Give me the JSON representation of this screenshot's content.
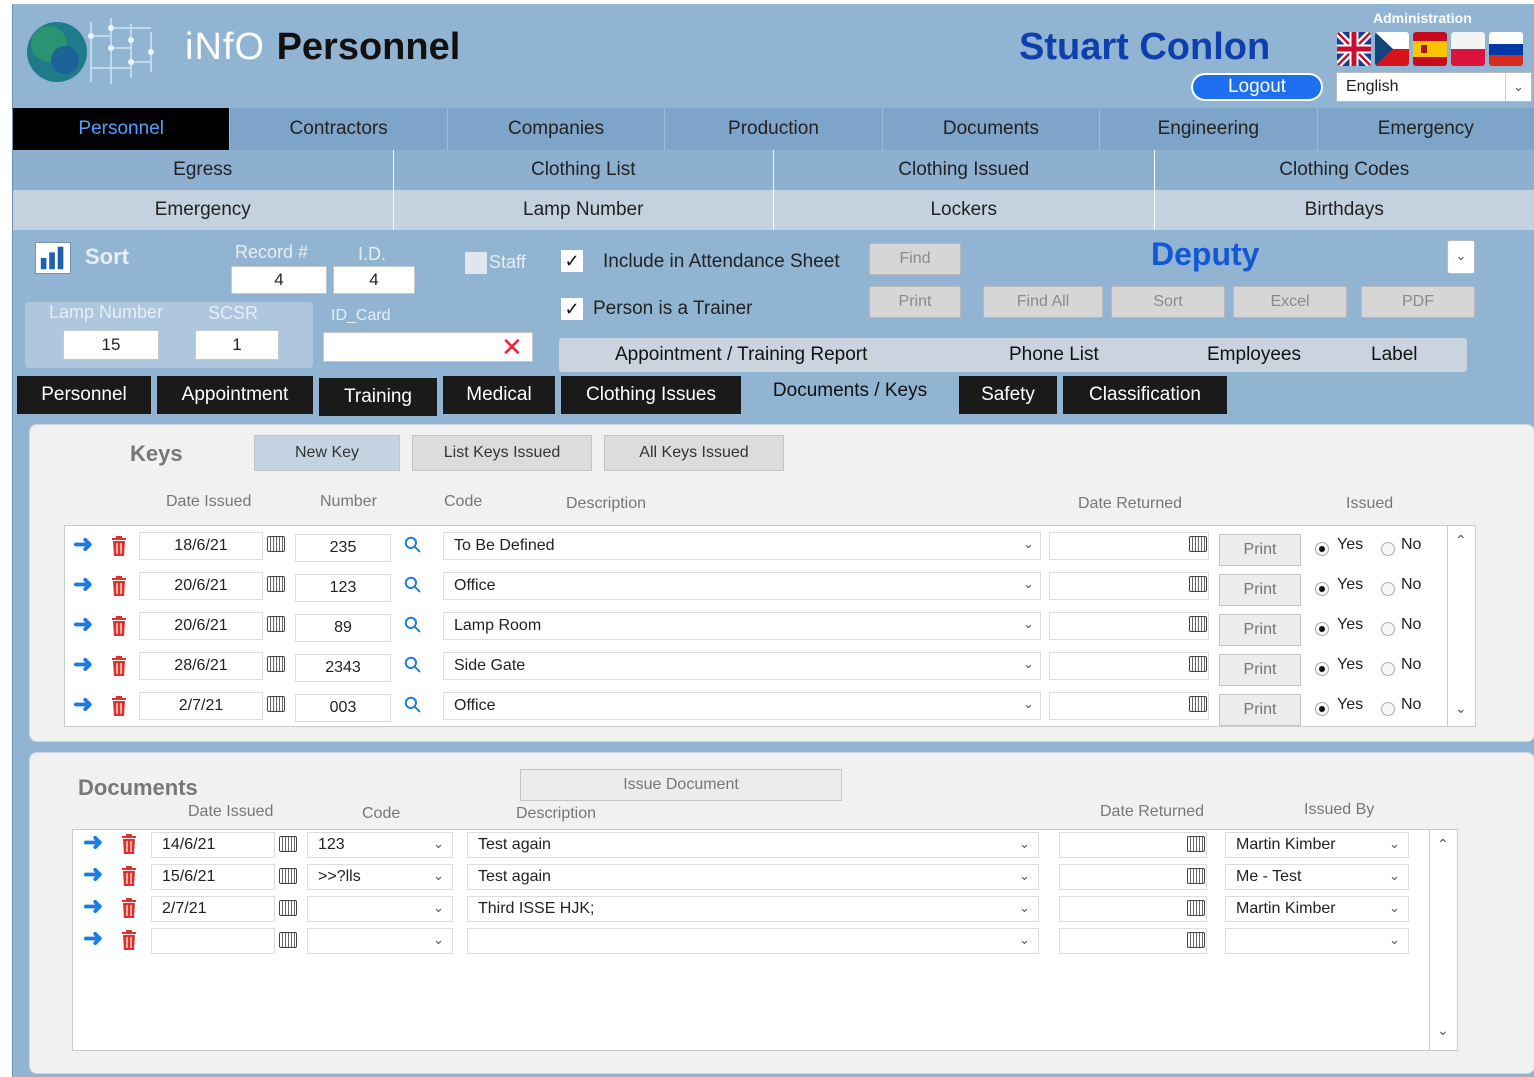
{
  "header": {
    "app_title_light": "iNfO",
    "app_title_bold": "Personnel",
    "user_name": "Stuart Conlon",
    "logout_label": "Logout",
    "admin_label": "Administration",
    "language_value": "English",
    "flags": [
      "uk-flag",
      "czech-flag",
      "spain-flag",
      "poland-flag",
      "russia-flag"
    ]
  },
  "main_nav": [
    "Personnel",
    "Contractors",
    "Companies",
    "Production",
    "Documents",
    "Engineering",
    "Emergency"
  ],
  "sub_nav_row1": [
    "Egress",
    "Clothing List",
    "Clothing Issued",
    "Clothing Codes"
  ],
  "sub_nav_row2": [
    "Emergency",
    "Lamp Number",
    "Lockers",
    "Birthdays"
  ],
  "record": {
    "sort_label": "Sort",
    "record_label": "Record #",
    "record_value": "4",
    "id_label": "I.D.",
    "id_value": "4",
    "lamp_label": "Lamp Number",
    "lamp_value": "15",
    "scsr_label": "SCSR",
    "scsr_value": "1",
    "idcard_label": "ID_Card",
    "idcard_value": "",
    "staff_label": "Staff",
    "attendance_label": "Include in Attendance Sheet",
    "trainer_label": "Person is a Trainer",
    "role_value": "Deputy"
  },
  "actions": {
    "find": "Find",
    "print": "Print",
    "find_all": "Find All",
    "sort": "Sort",
    "excel": "Excel",
    "pdf": "PDF"
  },
  "reports": [
    "Appointment / Training Report",
    "Phone List",
    "Employees",
    "Label"
  ],
  "tabs": [
    "Personnel",
    "Appointment",
    "Training",
    "Medical",
    "Clothing Issues",
    "Documents / Keys",
    "Safety",
    "Classification"
  ],
  "keys": {
    "title": "Keys",
    "new_key": "New Key",
    "list_keys": "List Keys Issued",
    "all_keys": "All Keys Issued",
    "columns": {
      "date_issued": "Date Issued",
      "number": "Number",
      "code": "Code",
      "description": "Description",
      "date_returned": "Date Returned",
      "issued": "Issued"
    },
    "print_label": "Print",
    "yes": "Yes",
    "no": "No",
    "rows": [
      {
        "date": "18/6/21",
        "number": "235",
        "description": "To Be Defined",
        "returned": ""
      },
      {
        "date": "20/6/21",
        "number": "123",
        "description": "Office",
        "returned": ""
      },
      {
        "date": "20/6/21",
        "number": "89",
        "description": "Lamp Room",
        "returned": ""
      },
      {
        "date": "28/6/21",
        "number": "2343",
        "description": "Side Gate",
        "returned": ""
      },
      {
        "date": "2/7/21",
        "number": "003",
        "description": "Office",
        "returned": ""
      }
    ]
  },
  "documents": {
    "title": "Documents",
    "issue_document": "Issue Document",
    "columns": {
      "date_issued": "Date Issued",
      "code": "Code",
      "description": "Description",
      "date_returned": "Date Returned",
      "issued_by": "Issued By"
    },
    "rows": [
      {
        "date": "14/6/21",
        "code": "123",
        "description": "Test again",
        "returned": "",
        "issued_by": "Martin Kimber"
      },
      {
        "date": "15/6/21",
        "code": ">>?lls",
        "description": "Test again",
        "returned": "",
        "issued_by": "Me - Test"
      },
      {
        "date": "2/7/21",
        "code": "",
        "description": "Third ISSE HJK;",
        "returned": "",
        "issued_by": "Martin Kimber"
      },
      {
        "date": "",
        "code": "",
        "description": "",
        "returned": "",
        "issued_by": ""
      }
    ]
  },
  "colors": {
    "app_bg": "#91b4d3",
    "nav_active_bg": "#000000",
    "nav_active_text": "#4da0ff",
    "username": "#0d3fae",
    "logout_bg": "#1d6ff0",
    "arrow": "#1a7ae8",
    "trash": "#e0312b"
  }
}
